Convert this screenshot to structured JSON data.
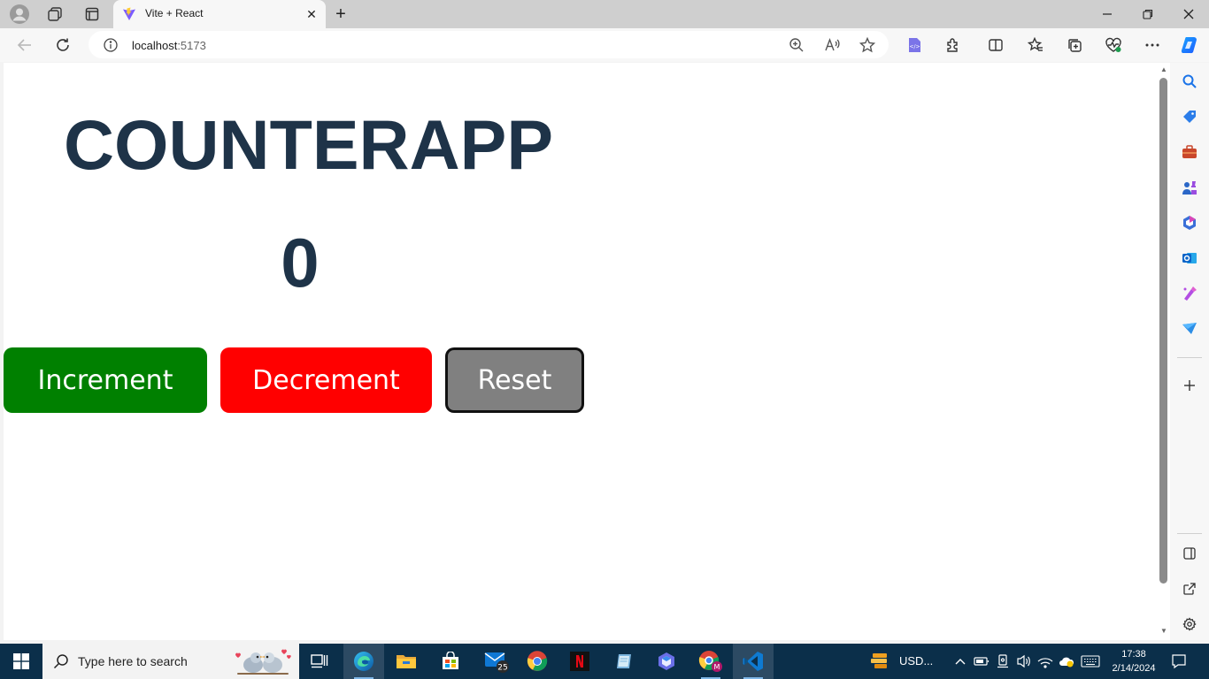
{
  "browser": {
    "tab_title": "Vite + React",
    "url_host": "localhost",
    "url_port": ":5173"
  },
  "app": {
    "title": "COUNTERAPP",
    "count": "0",
    "buttons": {
      "increment": "Increment",
      "decrement": "Decrement",
      "reset": "Reset"
    },
    "colors": {
      "title": "#1e3348",
      "increment": "#008000",
      "decrement": "#ff0000",
      "reset": "#808080"
    }
  },
  "taskbar": {
    "search_placeholder": "Type here to search",
    "mail_badge": "25",
    "weather_text": "USD...",
    "time": "17:38",
    "date": "2/14/2024"
  },
  "icons": {
    "tabstrip": [
      "profile-icon",
      "workspaces-icon",
      "tab-actions-icon",
      "vite-icon",
      "close-icon",
      "new-tab-icon",
      "minimize-icon",
      "restore-icon",
      "close-window-icon"
    ],
    "toolbar": [
      "back-icon",
      "refresh-icon",
      "info-icon",
      "zoom-icon",
      "read-aloud-icon",
      "favorite-icon",
      "extension-dev-icon",
      "extensions-icon",
      "split-screen-icon",
      "favorites-icon",
      "collections-icon",
      "performance-icon",
      "more-icon",
      "copilot-icon"
    ],
    "sidebar": [
      "search-icon",
      "shopping-icon",
      "tools-icon",
      "games-icon",
      "microsoft365-icon",
      "outlook-icon",
      "designer-icon",
      "send-icon",
      "add-icon",
      "sidebar-toggle-icon",
      "external-link-icon",
      "settings-icon"
    ]
  }
}
